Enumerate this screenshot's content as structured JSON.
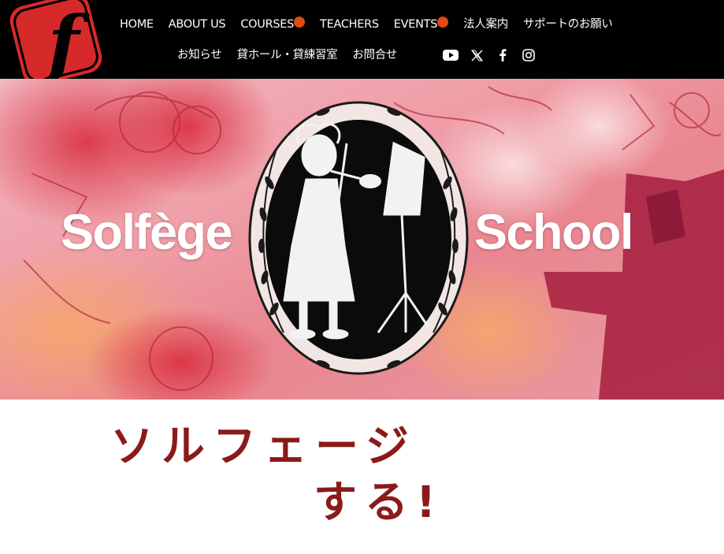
{
  "header": {
    "nav_row1": [
      {
        "label": "HOME"
      },
      {
        "label": "ABOUT US"
      },
      {
        "label": "COURSES"
      },
      {
        "label": "TEACHERS"
      },
      {
        "label": "EVENTS"
      },
      {
        "label": "法人案内"
      },
      {
        "label": "サポートのお願い"
      }
    ],
    "nav_row2": [
      {
        "label": "お知らせ"
      },
      {
        "label": "貸ホール・貸練習室"
      },
      {
        "label": "お問合せ"
      }
    ],
    "social": [
      "youtube-icon",
      "x-icon",
      "facebook-icon",
      "instagram-icon"
    ]
  },
  "hero": {
    "word_left": "Solfège",
    "word_right": "School"
  },
  "tagline": {
    "line1": "ソルフェージ",
    "line2": "する!"
  },
  "colors": {
    "header_bg": "#000000",
    "logo_red": "#d62a2a",
    "notification_dot": "#e14a12",
    "tagline": "#8b1a1a"
  }
}
